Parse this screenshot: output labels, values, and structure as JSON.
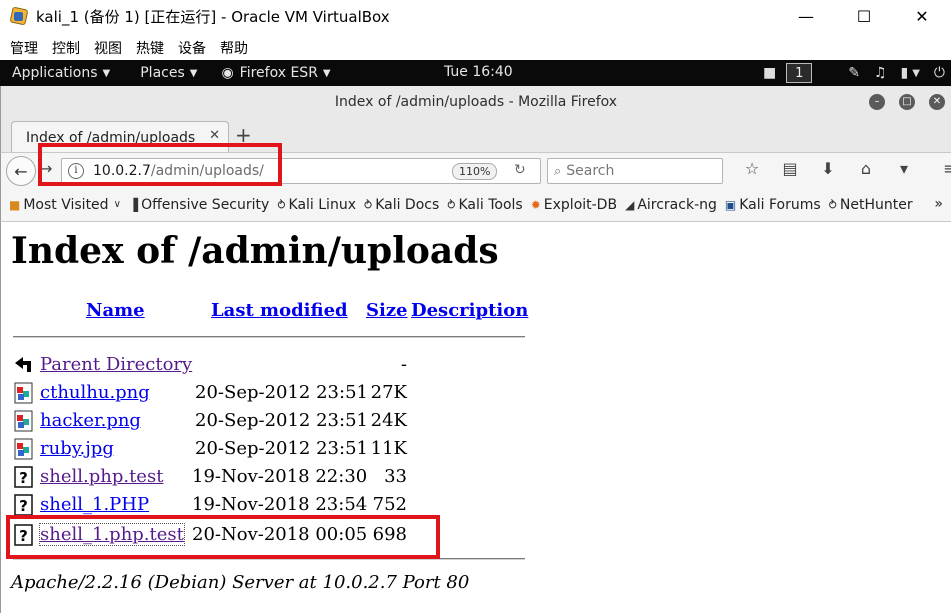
{
  "vbox": {
    "title": "kali_1 (备份 1) [正在运行] - Oracle VM VirtualBox",
    "menu": [
      "管理",
      "控制",
      "视图",
      "热键",
      "设备",
      "帮助"
    ]
  },
  "gnome": {
    "applications": "Applications",
    "places": "Places",
    "firefox": "Firefox ESR",
    "clock": "Tue 16:40",
    "workspace": "1"
  },
  "firefox": {
    "window_title": "Index of /admin/uploads - Mozilla Firefox",
    "tab_label": "Index of /admin/uploads",
    "url_host": "10.0.2.7",
    "url_path": "/admin/uploads/",
    "zoom": "110%",
    "search_placeholder": "Search",
    "bookmarks": [
      "Most Visited",
      "Offensive Security",
      "Kali Linux",
      "Kali Docs",
      "Kali Tools",
      "Exploit-DB",
      "Aircrack-ng",
      "Kali Forums",
      "NetHunter"
    ]
  },
  "page": {
    "heading": "Index of /admin/uploads",
    "columns": {
      "name": "Name",
      "modified": "Last modified",
      "size": "Size",
      "description": "Description"
    },
    "rows": [
      {
        "name": "Parent Directory",
        "date": "",
        "size": "-",
        "icon": "back-icon"
      },
      {
        "name": "cthulhu.png",
        "date": "20-Sep-2012 23:51",
        "size": "27K",
        "icon": "image-icon"
      },
      {
        "name": "hacker.png",
        "date": "20-Sep-2012 23:51",
        "size": "24K",
        "icon": "image-icon"
      },
      {
        "name": "ruby.jpg",
        "date": "20-Sep-2012 23:51",
        "size": "11K",
        "icon": "image-icon"
      },
      {
        "name": "shell.php.test",
        "date": "19-Nov-2018 22:30",
        "size": "33",
        "icon": "unknown-file-icon"
      },
      {
        "name": "shell_1.PHP",
        "date": "19-Nov-2018 23:54",
        "size": "752",
        "icon": "unknown-file-icon"
      },
      {
        "name": "shell_1.php.test",
        "date": "20-Nov-2018 00:05",
        "size": "698",
        "icon": "unknown-file-icon"
      }
    ],
    "address": "Apache/2.2.16 (Debian) Server at 10.0.2.7 Port 80"
  },
  "colors": {
    "link": "#0000ee",
    "visited": "#551a8b",
    "highlight": "#e0141b",
    "gnome_bar": "#0a0a0a"
  }
}
